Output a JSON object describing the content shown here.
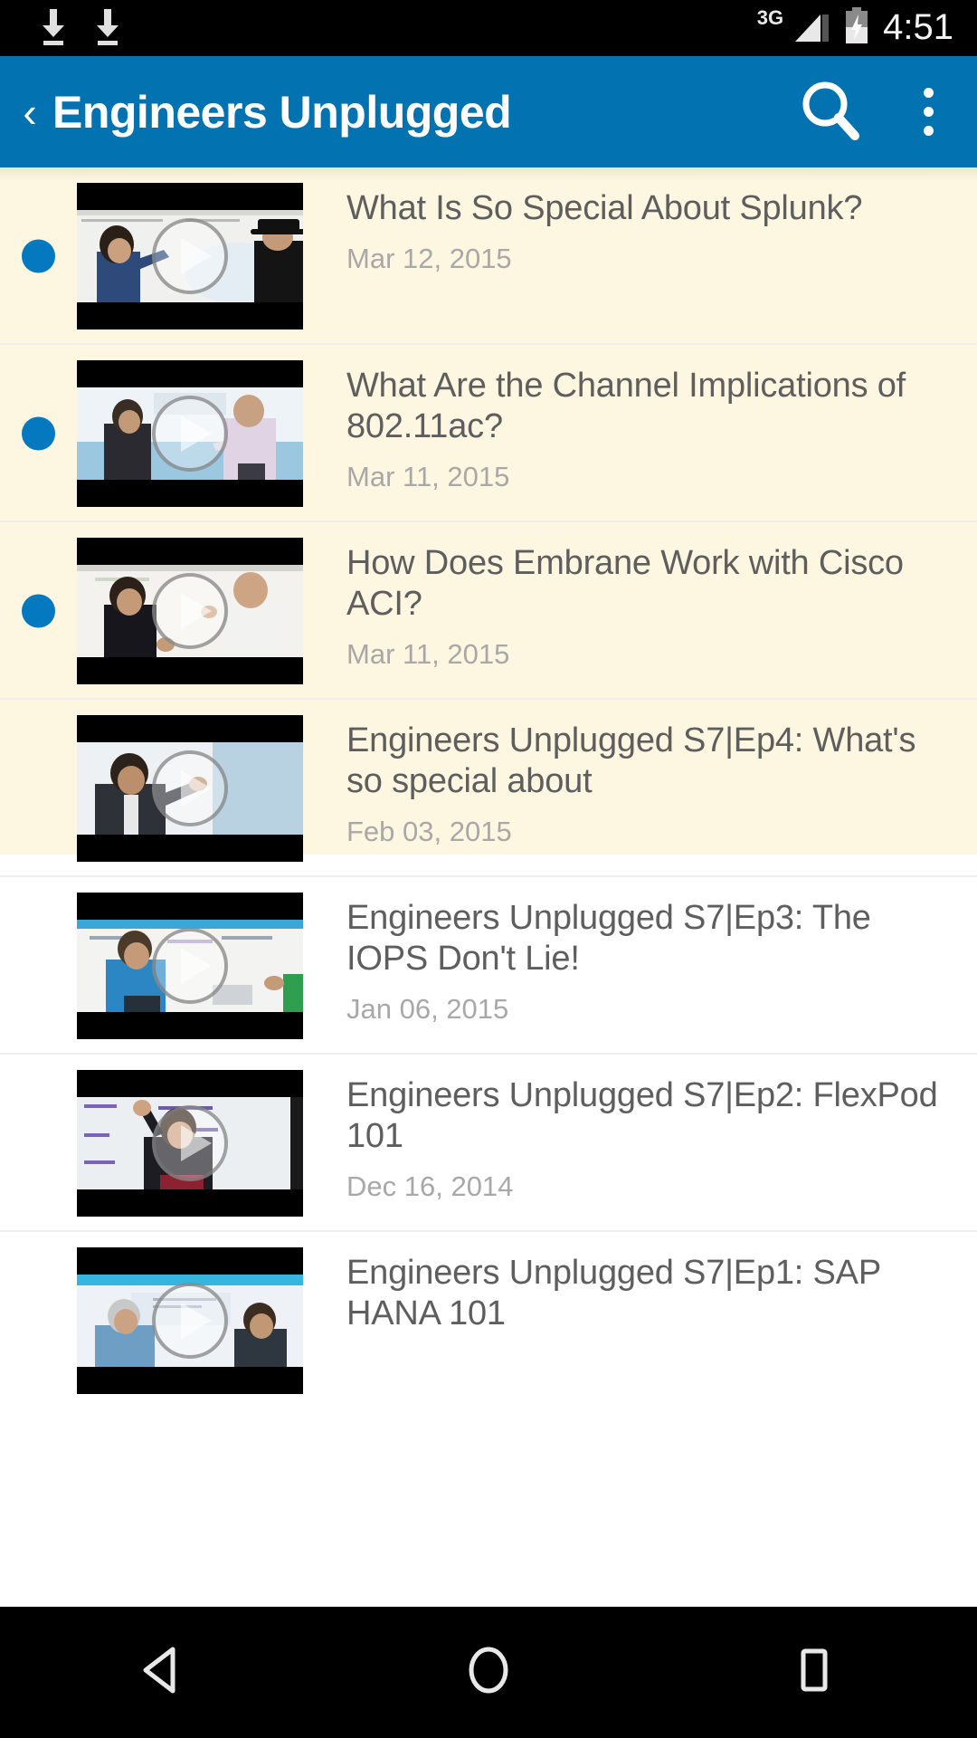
{
  "statusbar": {
    "notification_icons": [
      "download-icon",
      "download-icon"
    ],
    "network_type": "3G",
    "signal_icon": "signal-triangle-icon",
    "battery_icon": "battery-charging-icon",
    "time": "4:51"
  },
  "toolbar": {
    "back_icon": "back-chevron-icon",
    "title": "Engineers Unplugged",
    "search_icon": "search-icon",
    "overflow_icon": "overflow-menu-icon",
    "background_color": "#0273b0"
  },
  "colors": {
    "accent_blue": "#0273b0",
    "dot_blue": "#0579bf",
    "highlight_row_bg": "#fdf6e0",
    "normal_row_bg": "#ffffff",
    "title_text": "#5e5e5e",
    "date_text": "#a8a8a8",
    "divider": "#eeeeee"
  },
  "list": {
    "items": [
      {
        "title": "What Is So Special About Splunk?",
        "date": "Mar 12, 2015",
        "highlighted": true,
        "unread_dot": true,
        "thumbnail": "video-thumbnail",
        "play_icon": "play-icon"
      },
      {
        "title": "What Are the Channel Implications of 802.11ac?",
        "date": "Mar 11, 2015",
        "highlighted": true,
        "unread_dot": true,
        "thumbnail": "video-thumbnail",
        "play_icon": "play-icon"
      },
      {
        "title": "How Does Embrane Work with Cisco ACI?",
        "date": "Mar 11, 2015",
        "highlighted": true,
        "unread_dot": true,
        "thumbnail": "video-thumbnail",
        "play_icon": "play-icon"
      },
      {
        "title": "Engineers Unplugged S7|Ep4: What's so special about",
        "date": "Feb 03, 2015",
        "highlighted": false,
        "unread_dot": false,
        "thumbnail": "video-thumbnail",
        "play_icon": "play-icon"
      },
      {
        "title": "Engineers Unplugged S7|Ep3: The IOPS Don't Lie!",
        "date": "Jan 06, 2015",
        "highlighted": false,
        "unread_dot": false,
        "thumbnail": "video-thumbnail",
        "play_icon": "play-icon"
      },
      {
        "title": "Engineers Unplugged S7|Ep2: FlexPod 101",
        "date": "Dec 16, 2014",
        "highlighted": false,
        "unread_dot": false,
        "thumbnail": "video-thumbnail",
        "play_icon": "play-icon"
      },
      {
        "title": "Engineers Unplugged S7|Ep1: SAP HANA 101",
        "date": "",
        "highlighted": false,
        "unread_dot": false,
        "thumbnail": "video-thumbnail",
        "play_icon": "play-icon"
      }
    ]
  },
  "navbar": {
    "back_icon": "nav-back-triangle-icon",
    "home_icon": "nav-home-circle-icon",
    "recents_icon": "nav-recents-square-icon"
  }
}
